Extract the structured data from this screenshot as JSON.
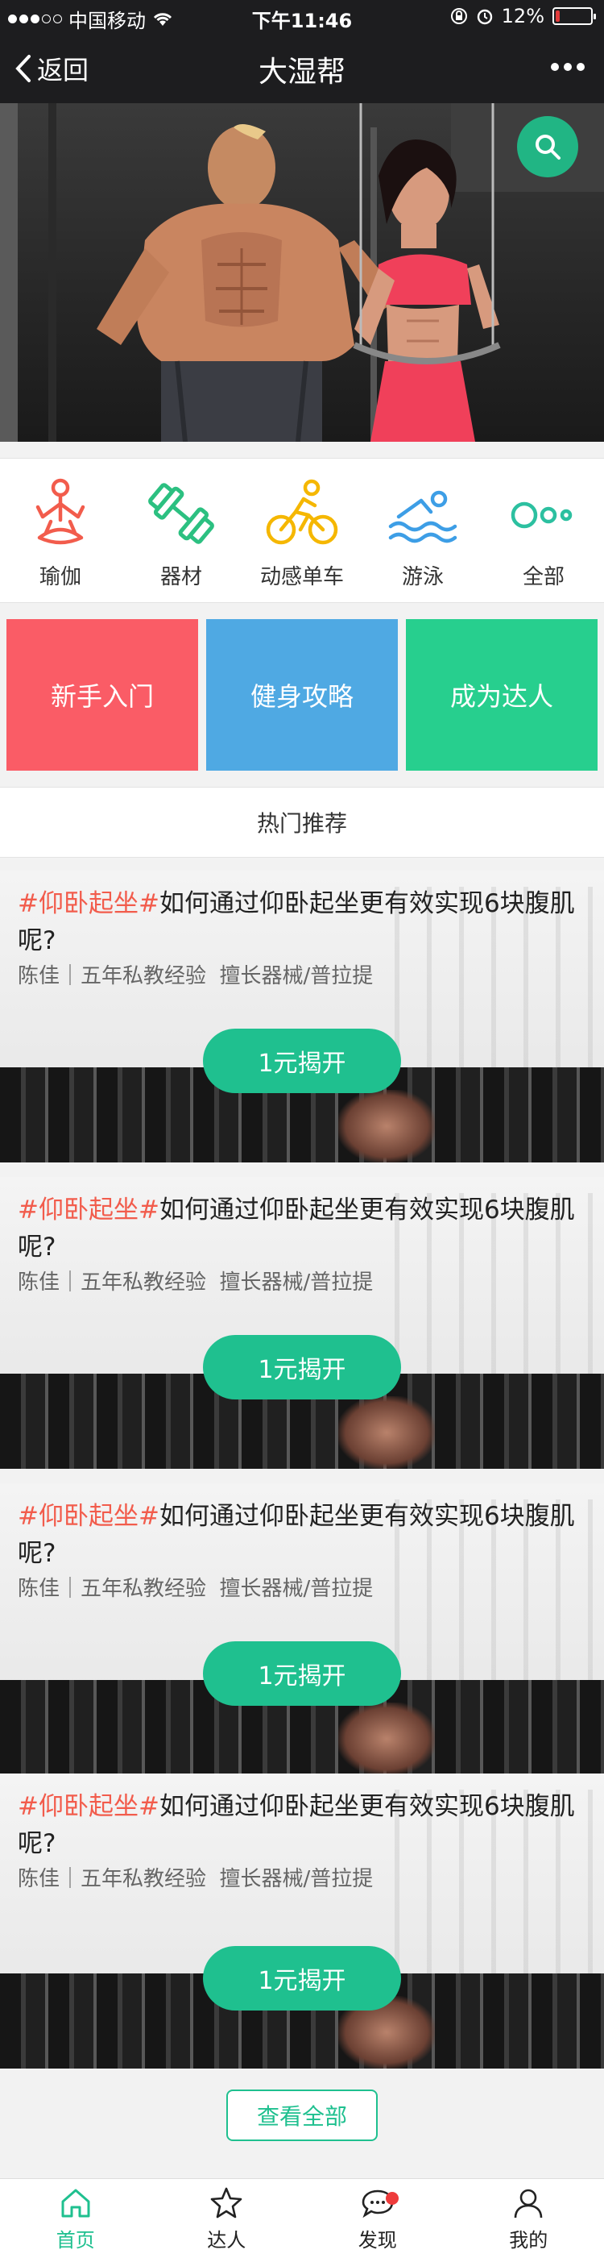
{
  "status_bar": {
    "carrier": "中国移动",
    "time": "下午11:46",
    "battery": "12%",
    "battery_level": 0.12
  },
  "nav": {
    "back_label": "返回",
    "title": "大湿帮"
  },
  "categories": [
    {
      "label": "瑜伽",
      "icon": "yoga-icon",
      "color": "#f25c4c"
    },
    {
      "label": "器材",
      "icon": "dumbbell-icon",
      "color": "#2cc081"
    },
    {
      "label": "动感单车",
      "icon": "cycling-icon",
      "color": "#f5b700"
    },
    {
      "label": "游泳",
      "icon": "swimming-icon",
      "color": "#3d9ee6"
    },
    {
      "label": "全部",
      "icon": "more-circles-icon",
      "color": "#2cc0a0"
    }
  ],
  "tiles": [
    {
      "label": "新手入门",
      "color": "#fa5c66"
    },
    {
      "label": "健身攻略",
      "color": "#4fa9e3"
    },
    {
      "label": "成为达人",
      "color": "#27cf8e"
    }
  ],
  "hot_title": "热门推荐",
  "cards": [
    {
      "tag": "#仰卧起坐#",
      "title": "如何通过仰卧起坐更有效实现6块腹肌呢?",
      "meta": "陈佳｜五年私教经验  擅长器械/普拉提",
      "button": "1元揭开"
    },
    {
      "tag": "#仰卧起坐#",
      "title": "如何通过仰卧起坐更有效实现6块腹肌呢?",
      "meta": "陈佳｜五年私教经验  擅长器械/普拉提",
      "button": "1元揭开"
    },
    {
      "tag": "#仰卧起坐#",
      "title": "如何通过仰卧起坐更有效实现6块腹肌呢?",
      "meta": "陈佳｜五年私教经验  擅长器械/普拉提",
      "button": "1元揭开"
    },
    {
      "tag": "#仰卧起坐#",
      "title": "如何通过仰卧起坐更有效实现6块腹肌呢?",
      "meta": "陈佳｜五年私教经验  擅长器械/普拉提",
      "button": "1元揭开"
    }
  ],
  "view_all": "查看全部",
  "tabs": [
    {
      "label": "首页",
      "icon": "home-icon",
      "active": true
    },
    {
      "label": "达人",
      "icon": "star-icon",
      "active": false
    },
    {
      "label": "发现",
      "icon": "chat-bubble-icon",
      "active": false,
      "badge": true
    },
    {
      "label": "我的",
      "icon": "user-icon",
      "active": false
    }
  ],
  "colors": {
    "accent": "#1fc08f",
    "tag": "#f25c4c",
    "bar_bg": "#1d1d1f"
  }
}
